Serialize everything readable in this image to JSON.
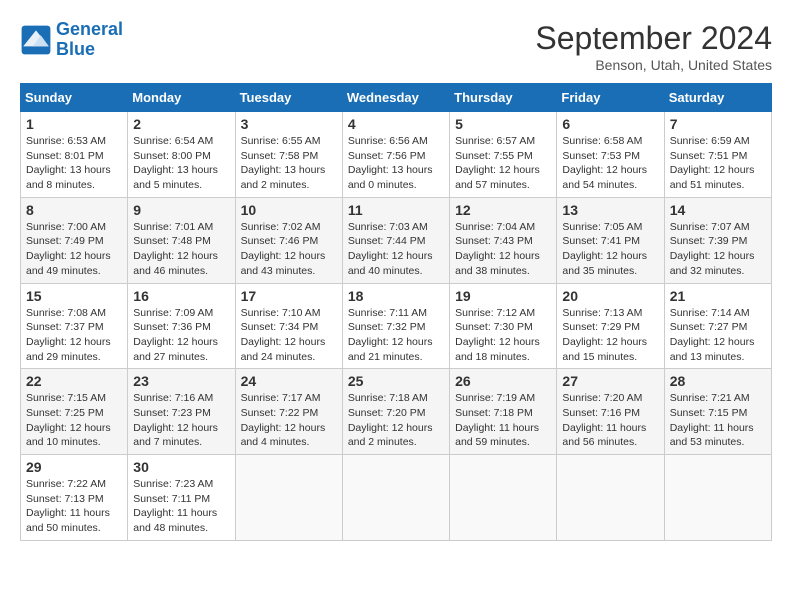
{
  "logo": {
    "line1": "General",
    "line2": "Blue"
  },
  "title": "September 2024",
  "subtitle": "Benson, Utah, United States",
  "days_of_week": [
    "Sunday",
    "Monday",
    "Tuesday",
    "Wednesday",
    "Thursday",
    "Friday",
    "Saturday"
  ],
  "weeks": [
    [
      {
        "day": "1",
        "sunrise": "6:53 AM",
        "sunset": "8:01 PM",
        "daylight": "13 hours and 8 minutes."
      },
      {
        "day": "2",
        "sunrise": "6:54 AM",
        "sunset": "8:00 PM",
        "daylight": "13 hours and 5 minutes."
      },
      {
        "day": "3",
        "sunrise": "6:55 AM",
        "sunset": "7:58 PM",
        "daylight": "13 hours and 2 minutes."
      },
      {
        "day": "4",
        "sunrise": "6:56 AM",
        "sunset": "7:56 PM",
        "daylight": "13 hours and 0 minutes."
      },
      {
        "day": "5",
        "sunrise": "6:57 AM",
        "sunset": "7:55 PM",
        "daylight": "12 hours and 57 minutes."
      },
      {
        "day": "6",
        "sunrise": "6:58 AM",
        "sunset": "7:53 PM",
        "daylight": "12 hours and 54 minutes."
      },
      {
        "day": "7",
        "sunrise": "6:59 AM",
        "sunset": "7:51 PM",
        "daylight": "12 hours and 51 minutes."
      }
    ],
    [
      {
        "day": "8",
        "sunrise": "7:00 AM",
        "sunset": "7:49 PM",
        "daylight": "12 hours and 49 minutes."
      },
      {
        "day": "9",
        "sunrise": "7:01 AM",
        "sunset": "7:48 PM",
        "daylight": "12 hours and 46 minutes."
      },
      {
        "day": "10",
        "sunrise": "7:02 AM",
        "sunset": "7:46 PM",
        "daylight": "12 hours and 43 minutes."
      },
      {
        "day": "11",
        "sunrise": "7:03 AM",
        "sunset": "7:44 PM",
        "daylight": "12 hours and 40 minutes."
      },
      {
        "day": "12",
        "sunrise": "7:04 AM",
        "sunset": "7:43 PM",
        "daylight": "12 hours and 38 minutes."
      },
      {
        "day": "13",
        "sunrise": "7:05 AM",
        "sunset": "7:41 PM",
        "daylight": "12 hours and 35 minutes."
      },
      {
        "day": "14",
        "sunrise": "7:07 AM",
        "sunset": "7:39 PM",
        "daylight": "12 hours and 32 minutes."
      }
    ],
    [
      {
        "day": "15",
        "sunrise": "7:08 AM",
        "sunset": "7:37 PM",
        "daylight": "12 hours and 29 minutes."
      },
      {
        "day": "16",
        "sunrise": "7:09 AM",
        "sunset": "7:36 PM",
        "daylight": "12 hours and 27 minutes."
      },
      {
        "day": "17",
        "sunrise": "7:10 AM",
        "sunset": "7:34 PM",
        "daylight": "12 hours and 24 minutes."
      },
      {
        "day": "18",
        "sunrise": "7:11 AM",
        "sunset": "7:32 PM",
        "daylight": "12 hours and 21 minutes."
      },
      {
        "day": "19",
        "sunrise": "7:12 AM",
        "sunset": "7:30 PM",
        "daylight": "12 hours and 18 minutes."
      },
      {
        "day": "20",
        "sunrise": "7:13 AM",
        "sunset": "7:29 PM",
        "daylight": "12 hours and 15 minutes."
      },
      {
        "day": "21",
        "sunrise": "7:14 AM",
        "sunset": "7:27 PM",
        "daylight": "12 hours and 13 minutes."
      }
    ],
    [
      {
        "day": "22",
        "sunrise": "7:15 AM",
        "sunset": "7:25 PM",
        "daylight": "12 hours and 10 minutes."
      },
      {
        "day": "23",
        "sunrise": "7:16 AM",
        "sunset": "7:23 PM",
        "daylight": "12 hours and 7 minutes."
      },
      {
        "day": "24",
        "sunrise": "7:17 AM",
        "sunset": "7:22 PM",
        "daylight": "12 hours and 4 minutes."
      },
      {
        "day": "25",
        "sunrise": "7:18 AM",
        "sunset": "7:20 PM",
        "daylight": "12 hours and 2 minutes."
      },
      {
        "day": "26",
        "sunrise": "7:19 AM",
        "sunset": "7:18 PM",
        "daylight": "11 hours and 59 minutes."
      },
      {
        "day": "27",
        "sunrise": "7:20 AM",
        "sunset": "7:16 PM",
        "daylight": "11 hours and 56 minutes."
      },
      {
        "day": "28",
        "sunrise": "7:21 AM",
        "sunset": "7:15 PM",
        "daylight": "11 hours and 53 minutes."
      }
    ],
    [
      {
        "day": "29",
        "sunrise": "7:22 AM",
        "sunset": "7:13 PM",
        "daylight": "11 hours and 50 minutes."
      },
      {
        "day": "30",
        "sunrise": "7:23 AM",
        "sunset": "7:11 PM",
        "daylight": "11 hours and 48 minutes."
      },
      null,
      null,
      null,
      null,
      null
    ]
  ]
}
